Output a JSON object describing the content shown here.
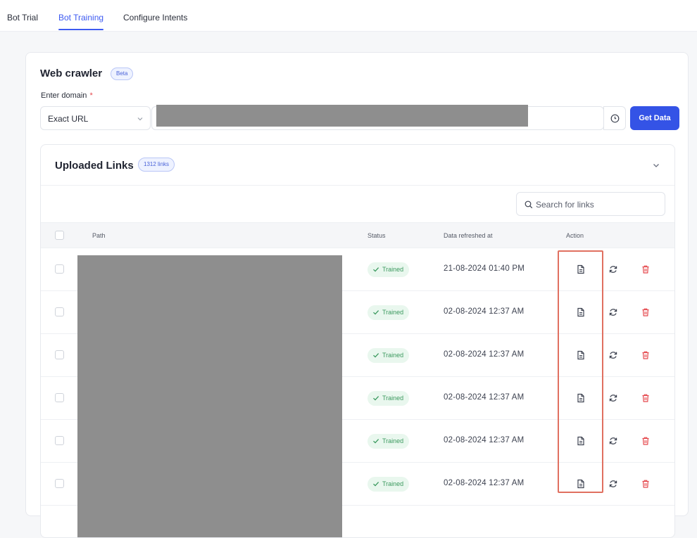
{
  "tabs": [
    {
      "label": "Bot Trial"
    },
    {
      "label": "Bot Training",
      "active": true
    },
    {
      "label": "Configure Intents"
    }
  ],
  "crawler": {
    "title": "Web crawler",
    "badge": "Beta",
    "domain_label": "Enter domain",
    "required_mark": "*",
    "match_type": "Exact URL",
    "get_data_label": "Get Data"
  },
  "uploaded": {
    "title": "Uploaded Links",
    "count_badge": "1312 links",
    "search_placeholder": "Search for links",
    "columns": {
      "path": "Path",
      "status": "Status",
      "refreshed": "Data refreshed at",
      "action": "Action"
    },
    "rows": [
      {
        "status": "Trained",
        "refreshed": "21-08-2024 01:40 PM"
      },
      {
        "status": "Trained",
        "refreshed": "02-08-2024 12:37 AM"
      },
      {
        "status": "Trained",
        "refreshed": "02-08-2024 12:37 AM"
      },
      {
        "status": "Trained",
        "refreshed": "02-08-2024 12:37 AM"
      },
      {
        "status": "Trained",
        "refreshed": "02-08-2024 12:37 AM"
      },
      {
        "status": "Trained",
        "refreshed": "02-08-2024 12:37 AM"
      }
    ]
  },
  "colors": {
    "accent": "#3453e6",
    "success": "#3c9a5f",
    "danger": "#e5484d",
    "highlight": "#e07060"
  },
  "icons": {
    "help": "help-circle-icon",
    "search": "search-icon",
    "view": "document-icon",
    "refresh": "refresh-icon",
    "delete": "trash-icon",
    "check": "check-icon",
    "chevron": "chevron-down-icon"
  }
}
